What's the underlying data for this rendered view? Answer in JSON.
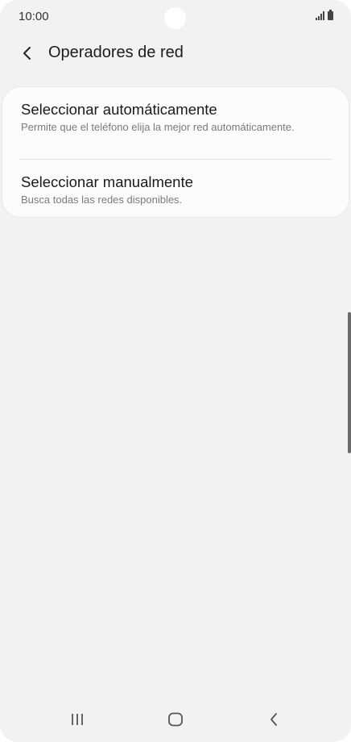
{
  "status_bar": {
    "time": "10:00",
    "icons": [
      "signal-icon",
      "battery-icon"
    ]
  },
  "header": {
    "back_icon": "chevron-left-icon",
    "title": "Operadores de red"
  },
  "options": [
    {
      "title": "Seleccionar automáticamente",
      "description": "Permite que el teléfono elija la mejor red automáticamente."
    },
    {
      "title": "Seleccionar manualmente",
      "description": "Busca todas las redes disponibles."
    }
  ],
  "nav_bar": {
    "recent_icon": "recent-apps-icon",
    "home_icon": "home-icon",
    "back_icon": "back-icon"
  }
}
